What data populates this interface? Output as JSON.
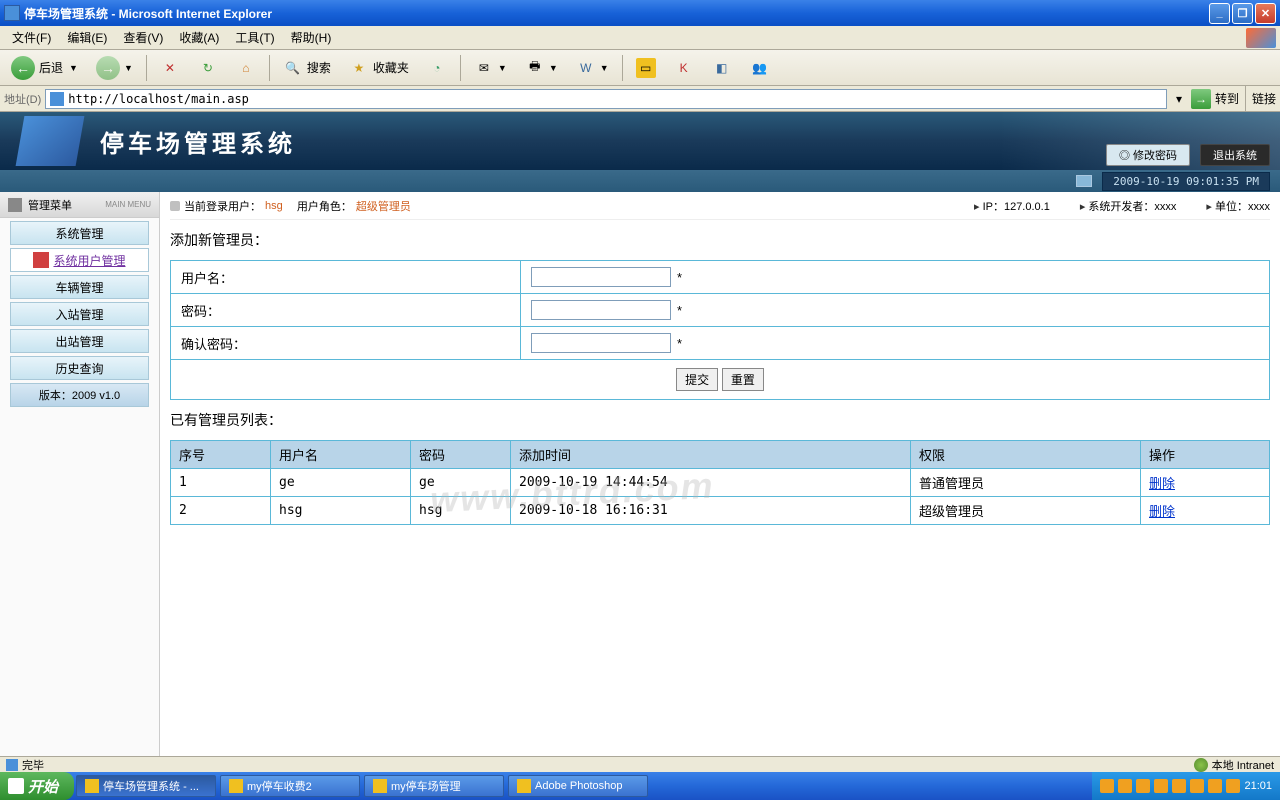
{
  "window": {
    "title": "停车场管理系统 - Microsoft Internet Explorer"
  },
  "menu": {
    "file": "文件(F)",
    "edit": "编辑(E)",
    "view": "查看(V)",
    "favorites": "收藏(A)",
    "tools": "工具(T)",
    "help": "帮助(H)"
  },
  "toolbar": {
    "back": "后退",
    "search": "搜索",
    "favorites": "收藏夹"
  },
  "address": {
    "label": "地址(D)",
    "url": "http://localhost/main.asp",
    "go": "转到",
    "links": "链接"
  },
  "app": {
    "title": "停车场管理系统",
    "change_pwd": "◎ 修改密码",
    "logout": "退出系统",
    "timestamp": "2009-10-19 09:01:35 PM"
  },
  "sidebar": {
    "title": "管理菜单",
    "subtitle": "MAIN MENU",
    "items": [
      "系统管理",
      "系统用户管理",
      "车辆管理",
      "入站管理",
      "出站管理",
      "历史查询"
    ],
    "version": "版本：2009 v1.0"
  },
  "status": {
    "login_label": "当前登录用户：",
    "login_user": "hsg",
    "role_label": "用户角色：",
    "role_value": "超级管理员",
    "ip": "IP：127.0.0.1",
    "dev": "系统开发者：xxxx",
    "unit": "单位：xxxx"
  },
  "form": {
    "title": "添加新管理员：",
    "username": "用户名：",
    "password": "密码：",
    "confirm": "确认密码：",
    "req": "*",
    "submit": "提交",
    "reset": "重置"
  },
  "list": {
    "title": "已有管理员列表：",
    "headers": {
      "seq": "序号",
      "user": "用户名",
      "pwd": "密码",
      "time": "添加时间",
      "role": "权限",
      "op": "操作"
    },
    "rows": [
      {
        "seq": "1",
        "user": "ge",
        "pwd": "ge",
        "time": "2009-10-19 14:44:54",
        "role": "普通管理员",
        "op": "删除"
      },
      {
        "seq": "2",
        "user": "hsg",
        "pwd": "hsg",
        "time": "2009-10-18 16:16:31",
        "role": "超级管理员",
        "op": "删除"
      }
    ]
  },
  "watermark": "www.bttrd.com",
  "ie_status": {
    "done": "完毕",
    "zone": "本地 Intranet"
  },
  "taskbar": {
    "start": "开始",
    "tasks": [
      "停车场管理系统 - ...",
      "my停车收费2",
      "my停车场管理",
      "Adobe Photoshop"
    ],
    "clock": "21:01"
  }
}
